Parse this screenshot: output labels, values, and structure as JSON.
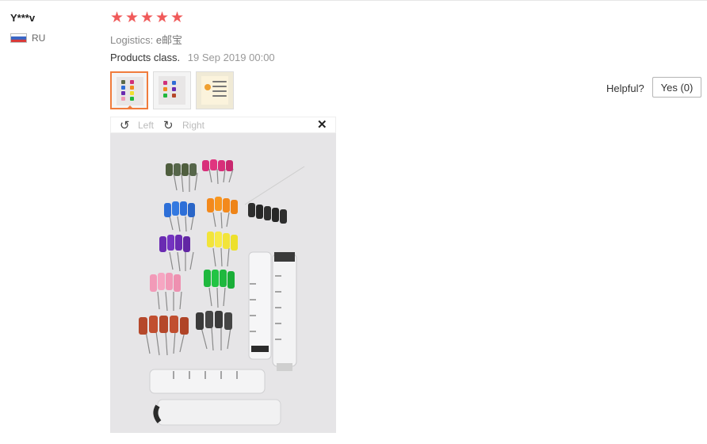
{
  "review": {
    "username": "Y***v",
    "country": "RU",
    "rating": 5,
    "stars": [
      "★",
      "★",
      "★",
      "★",
      "★"
    ],
    "logistics_label": "Logistics:",
    "logistics_value": "e邮宝",
    "product_class": "Products class.",
    "date": "19 Sep 2019 00:00",
    "helpful_label": "Helpful?",
    "yes_button": "Yes (0)"
  },
  "thumbnails": [
    {
      "name": "photo-1",
      "active": true
    },
    {
      "name": "photo-2",
      "active": false
    },
    {
      "name": "photo-3",
      "active": false
    }
  ],
  "viewer": {
    "rotate_left_icon": "↺",
    "rotate_left_label": "Left",
    "rotate_right_icon": "↻",
    "rotate_right_label": "Right",
    "close_icon": "✕"
  },
  "colors": {
    "star": "#f05a5a",
    "active_thumb_border": "#f07c3c",
    "flag": [
      "#ffffff",
      "#3a66c4",
      "#d83a3a"
    ]
  }
}
